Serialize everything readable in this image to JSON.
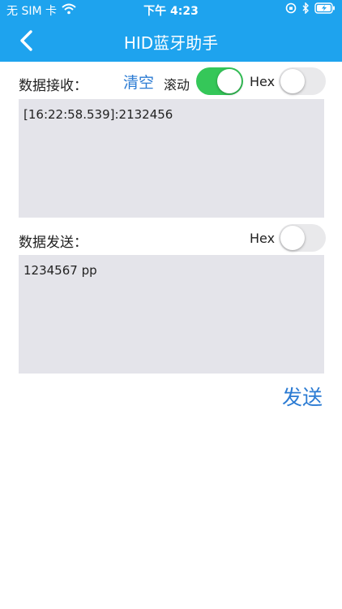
{
  "status": {
    "carrier": "无 SIM 卡",
    "time": "下午 4:23"
  },
  "nav": {
    "title": "HID蓝牙助手"
  },
  "receive": {
    "label": "数据接收：",
    "clear": "清空",
    "scroll_label": "滚动",
    "scroll_on": true,
    "hex_label": "Hex",
    "hex_on": false,
    "content": "[16:22:58.539]:2132456"
  },
  "send": {
    "label": "数据发送：",
    "hex_label": "Hex",
    "hex_on": false,
    "content": "1234567 pp",
    "button": "发送"
  },
  "colors": {
    "header": "#1ea3ee",
    "toggle_on": "#35c759",
    "accent": "#2b7bd3",
    "box": "#e4e4ea"
  }
}
